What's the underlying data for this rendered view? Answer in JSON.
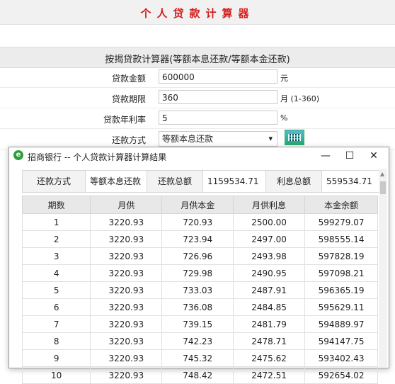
{
  "page_title": "个人贷款计算器",
  "form": {
    "header": "按揭贷款计算器(等额本息还款/等额本金还款)",
    "amount_label": "贷款金额",
    "amount_value": "600000",
    "amount_unit": "元",
    "term_label": "贷款期限",
    "term_value": "360",
    "term_unit": "月 (1-360)",
    "rate_label": "贷款年利率",
    "rate_value": "5",
    "rate_unit": "%",
    "method_label": "还款方式",
    "method_value": "等额本息还款",
    "calc_button_icon": "calculator-icon"
  },
  "popup": {
    "title": "招商银行 -- 个人贷款计算器计算结果",
    "browser_icon": "e",
    "summary": {
      "method_label": "还款方式",
      "method_value": "等额本息还款",
      "total_label": "还款总额",
      "total_value": "1159534.71",
      "interest_label": "利息总额",
      "interest_value": "559534.71"
    },
    "table": {
      "headers": [
        "期数",
        "月供",
        "月供本金",
        "月供利息",
        "本金余额"
      ],
      "rows": [
        [
          "1",
          "3220.93",
          "720.93",
          "2500.00",
          "599279.07"
        ],
        [
          "2",
          "3220.93",
          "723.94",
          "2497.00",
          "598555.14"
        ],
        [
          "3",
          "3220.93",
          "726.96",
          "2493.98",
          "597828.19"
        ],
        [
          "4",
          "3220.93",
          "729.98",
          "2490.95",
          "597098.21"
        ],
        [
          "5",
          "3220.93",
          "733.03",
          "2487.91",
          "596365.19"
        ],
        [
          "6",
          "3220.93",
          "736.08",
          "2484.85",
          "595629.11"
        ],
        [
          "7",
          "3220.93",
          "739.15",
          "2481.79",
          "594889.97"
        ],
        [
          "8",
          "3220.93",
          "742.23",
          "2478.71",
          "594147.75"
        ],
        [
          "9",
          "3220.93",
          "745.32",
          "2475.62",
          "593402.43"
        ],
        [
          "10",
          "3220.93",
          "748.42",
          "2472.51",
          "592654.02"
        ]
      ]
    }
  }
}
